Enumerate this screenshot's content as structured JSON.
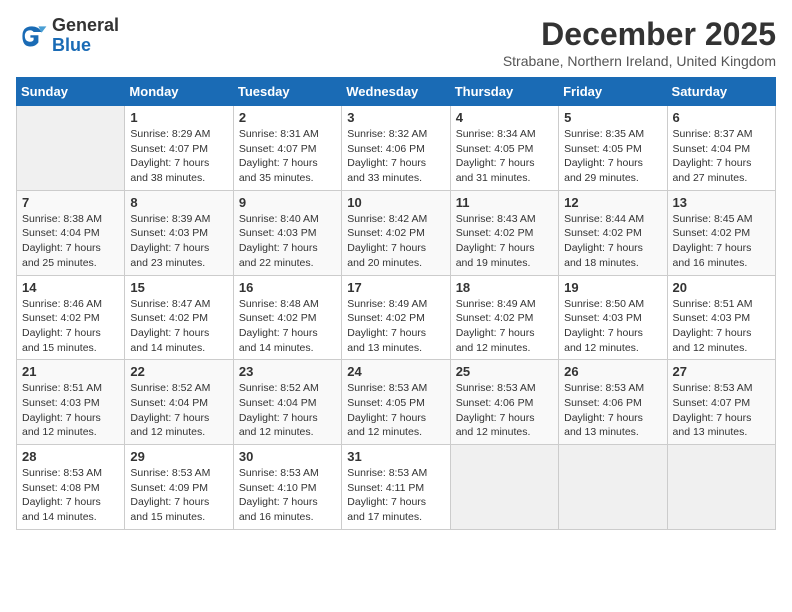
{
  "header": {
    "logo_general": "General",
    "logo_blue": "Blue",
    "month_title": "December 2025",
    "location": "Strabane, Northern Ireland, United Kingdom"
  },
  "days_of_week": [
    "Sunday",
    "Monday",
    "Tuesday",
    "Wednesday",
    "Thursday",
    "Friday",
    "Saturday"
  ],
  "weeks": [
    [
      {
        "day": "",
        "info": ""
      },
      {
        "day": "1",
        "info": "Sunrise: 8:29 AM\nSunset: 4:07 PM\nDaylight: 7 hours\nand 38 minutes."
      },
      {
        "day": "2",
        "info": "Sunrise: 8:31 AM\nSunset: 4:07 PM\nDaylight: 7 hours\nand 35 minutes."
      },
      {
        "day": "3",
        "info": "Sunrise: 8:32 AM\nSunset: 4:06 PM\nDaylight: 7 hours\nand 33 minutes."
      },
      {
        "day": "4",
        "info": "Sunrise: 8:34 AM\nSunset: 4:05 PM\nDaylight: 7 hours\nand 31 minutes."
      },
      {
        "day": "5",
        "info": "Sunrise: 8:35 AM\nSunset: 4:05 PM\nDaylight: 7 hours\nand 29 minutes."
      },
      {
        "day": "6",
        "info": "Sunrise: 8:37 AM\nSunset: 4:04 PM\nDaylight: 7 hours\nand 27 minutes."
      }
    ],
    [
      {
        "day": "7",
        "info": "Sunrise: 8:38 AM\nSunset: 4:04 PM\nDaylight: 7 hours\nand 25 minutes."
      },
      {
        "day": "8",
        "info": "Sunrise: 8:39 AM\nSunset: 4:03 PM\nDaylight: 7 hours\nand 23 minutes."
      },
      {
        "day": "9",
        "info": "Sunrise: 8:40 AM\nSunset: 4:03 PM\nDaylight: 7 hours\nand 22 minutes."
      },
      {
        "day": "10",
        "info": "Sunrise: 8:42 AM\nSunset: 4:02 PM\nDaylight: 7 hours\nand 20 minutes."
      },
      {
        "day": "11",
        "info": "Sunrise: 8:43 AM\nSunset: 4:02 PM\nDaylight: 7 hours\nand 19 minutes."
      },
      {
        "day": "12",
        "info": "Sunrise: 8:44 AM\nSunset: 4:02 PM\nDaylight: 7 hours\nand 18 minutes."
      },
      {
        "day": "13",
        "info": "Sunrise: 8:45 AM\nSunset: 4:02 PM\nDaylight: 7 hours\nand 16 minutes."
      }
    ],
    [
      {
        "day": "14",
        "info": "Sunrise: 8:46 AM\nSunset: 4:02 PM\nDaylight: 7 hours\nand 15 minutes."
      },
      {
        "day": "15",
        "info": "Sunrise: 8:47 AM\nSunset: 4:02 PM\nDaylight: 7 hours\nand 14 minutes."
      },
      {
        "day": "16",
        "info": "Sunrise: 8:48 AM\nSunset: 4:02 PM\nDaylight: 7 hours\nand 14 minutes."
      },
      {
        "day": "17",
        "info": "Sunrise: 8:49 AM\nSunset: 4:02 PM\nDaylight: 7 hours\nand 13 minutes."
      },
      {
        "day": "18",
        "info": "Sunrise: 8:49 AM\nSunset: 4:02 PM\nDaylight: 7 hours\nand 12 minutes."
      },
      {
        "day": "19",
        "info": "Sunrise: 8:50 AM\nSunset: 4:03 PM\nDaylight: 7 hours\nand 12 minutes."
      },
      {
        "day": "20",
        "info": "Sunrise: 8:51 AM\nSunset: 4:03 PM\nDaylight: 7 hours\nand 12 minutes."
      }
    ],
    [
      {
        "day": "21",
        "info": "Sunrise: 8:51 AM\nSunset: 4:03 PM\nDaylight: 7 hours\nand 12 minutes."
      },
      {
        "day": "22",
        "info": "Sunrise: 8:52 AM\nSunset: 4:04 PM\nDaylight: 7 hours\nand 12 minutes."
      },
      {
        "day": "23",
        "info": "Sunrise: 8:52 AM\nSunset: 4:04 PM\nDaylight: 7 hours\nand 12 minutes."
      },
      {
        "day": "24",
        "info": "Sunrise: 8:53 AM\nSunset: 4:05 PM\nDaylight: 7 hours\nand 12 minutes."
      },
      {
        "day": "25",
        "info": "Sunrise: 8:53 AM\nSunset: 4:06 PM\nDaylight: 7 hours\nand 12 minutes."
      },
      {
        "day": "26",
        "info": "Sunrise: 8:53 AM\nSunset: 4:06 PM\nDaylight: 7 hours\nand 13 minutes."
      },
      {
        "day": "27",
        "info": "Sunrise: 8:53 AM\nSunset: 4:07 PM\nDaylight: 7 hours\nand 13 minutes."
      }
    ],
    [
      {
        "day": "28",
        "info": "Sunrise: 8:53 AM\nSunset: 4:08 PM\nDaylight: 7 hours\nand 14 minutes."
      },
      {
        "day": "29",
        "info": "Sunrise: 8:53 AM\nSunset: 4:09 PM\nDaylight: 7 hours\nand 15 minutes."
      },
      {
        "day": "30",
        "info": "Sunrise: 8:53 AM\nSunset: 4:10 PM\nDaylight: 7 hours\nand 16 minutes."
      },
      {
        "day": "31",
        "info": "Sunrise: 8:53 AM\nSunset: 4:11 PM\nDaylight: 7 hours\nand 17 minutes."
      },
      {
        "day": "",
        "info": ""
      },
      {
        "day": "",
        "info": ""
      },
      {
        "day": "",
        "info": ""
      }
    ]
  ]
}
